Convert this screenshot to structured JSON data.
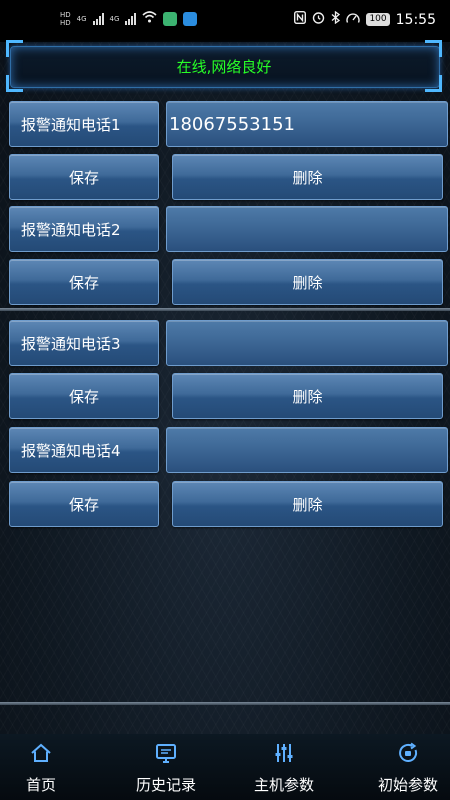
{
  "status_bar": {
    "network_tags": [
      "HD",
      "HD"
    ],
    "signal_label_1": "4G",
    "signal_label_2": "4G",
    "battery": "100",
    "time": "15:55"
  },
  "header": {
    "status_text": "在线,网络良好",
    "status_color": "#27ff27"
  },
  "phones": [
    {
      "label": "报警通知电话1",
      "value": "18067553151",
      "save": "保存",
      "delete": "删除"
    },
    {
      "label": "报警通知电话2",
      "value": "",
      "save": "保存",
      "delete": "删除"
    },
    {
      "label": "报警通知电话3",
      "value": "",
      "save": "保存",
      "delete": "删除"
    },
    {
      "label": "报警通知电话4",
      "value": "",
      "save": "保存",
      "delete": "删除"
    }
  ],
  "nav": {
    "items": [
      {
        "label": "首页",
        "icon": "home-icon"
      },
      {
        "label": "历史记录",
        "icon": "monitor-icon"
      },
      {
        "label": "主机参数",
        "icon": "sliders-icon"
      },
      {
        "label": "初始参数",
        "icon": "reset-icon"
      }
    ]
  },
  "colors": {
    "button_top": "#5d87b5",
    "button_bottom": "#244a76",
    "accent_border": "#4fb8ff",
    "background": "#0f1821"
  }
}
